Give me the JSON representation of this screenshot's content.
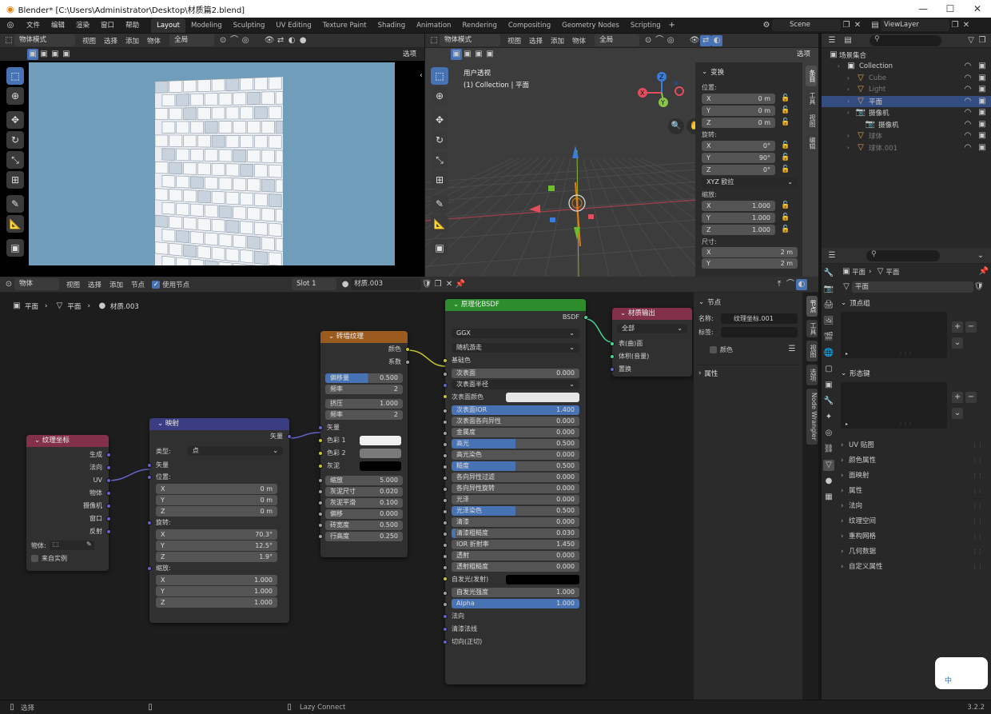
{
  "window": {
    "title": "Blender* [C:\\Users\\Administrator\\Desktop\\材质篇2.blend]",
    "min": "—",
    "max": "☐",
    "close": "✕"
  },
  "menu": [
    "文件",
    "编辑",
    "渲染",
    "窗口",
    "帮助"
  ],
  "workspaces": [
    "Layout",
    "Modeling",
    "Sculpting",
    "UV Editing",
    "Texture Paint",
    "Shading",
    "Animation",
    "Rendering",
    "Compositing",
    "Geometry Nodes",
    "Scripting"
  ],
  "active_workspace": "Layout",
  "scene": "Scene",
  "view_layer": "ViewLayer",
  "left_view": {
    "mode": "物体模式",
    "menus": [
      "视图",
      "选择",
      "添加",
      "物体"
    ],
    "transform": "全局",
    "options": "选项"
  },
  "right_view": {
    "mode": "物体模式",
    "menus": [
      "视图",
      "选择",
      "添加",
      "物体"
    ],
    "transform": "全局",
    "options": "选项",
    "overlay_title": "用户透视",
    "overlay_sub": "(1) Collection | 平面"
  },
  "n_panel": {
    "transform": "变换",
    "location_label": "位置:",
    "location": [
      [
        "X",
        "0 m"
      ],
      [
        "Y",
        "0 m"
      ],
      [
        "Z",
        "0 m"
      ]
    ],
    "rotation_label": "旋转:",
    "rotation": [
      [
        "X",
        "0°"
      ],
      [
        "Y",
        "90°"
      ],
      [
        "Z",
        "0°"
      ]
    ],
    "euler": "XYZ 欧拉",
    "scale_label": "缩放:",
    "scale": [
      [
        "X",
        "1.000"
      ],
      [
        "Y",
        "1.000"
      ],
      [
        "Z",
        "1.000"
      ]
    ],
    "dims_label": "尺寸:",
    "dims": [
      [
        "X",
        "2 m"
      ],
      [
        "Y",
        "2 m"
      ]
    ],
    "tabs": [
      "条目",
      "工具",
      "视图",
      "编辑"
    ]
  },
  "outliner": {
    "root": "场景集合",
    "items": [
      {
        "name": "Collection",
        "level": 1
      },
      {
        "name": "Cube",
        "level": 2,
        "dim": true
      },
      {
        "name": "Light",
        "level": 2,
        "dim": true
      },
      {
        "name": "平面",
        "level": 2,
        "selected": true
      },
      {
        "name": "摄像机",
        "level": 2
      },
      {
        "name": "摄像机",
        "level": 3
      },
      {
        "name": "球体",
        "level": 2,
        "dim": true
      },
      {
        "name": "球体.001",
        "level": 2,
        "dim": true
      }
    ]
  },
  "node_editor": {
    "header": {
      "object": "物体",
      "menus": [
        "视图",
        "选择",
        "添加",
        "节点"
      ],
      "use_nodes": "使用节点",
      "slot": "Slot 1",
      "material": "材质.003"
    },
    "breadcrumb": [
      "平面",
      "平面",
      "材质.003"
    ],
    "tabs": [
      "节点",
      "工具",
      "视图",
      "选项",
      "Node Wrangler"
    ]
  },
  "nodes": {
    "texcoord": {
      "title": "纹理坐标",
      "outputs": [
        "生成",
        "法向",
        "UV",
        "物体",
        "摄像机",
        "窗口",
        "反射"
      ],
      "object_label": "物体:",
      "from_instancer": "来自实例"
    },
    "mapping": {
      "title": "映射",
      "output": "矢量",
      "type_label": "类型:",
      "type": "点",
      "vector": "矢量",
      "location_label": "位置:",
      "location": [
        [
          "X",
          "0 m"
        ],
        [
          "Y",
          "0 m"
        ],
        [
          "Z",
          "0 m"
        ]
      ],
      "rotation_label": "旋转:",
      "rotation": [
        [
          "X",
          "70.3°"
        ],
        [
          "Y",
          "12.5°"
        ],
        [
          "Z",
          "1.9°"
        ]
      ],
      "scale_label": "缩放:",
      "scale": [
        [
          "X",
          "1.000"
        ],
        [
          "Y",
          "1.000"
        ],
        [
          "Z",
          "1.000"
        ]
      ]
    },
    "brick": {
      "title": "砖墙纹理",
      "outputs": [
        "颜色",
        "系数"
      ],
      "offset": [
        "偏移量",
        "0.500"
      ],
      "freq1": [
        "频率",
        "2"
      ],
      "squash": [
        "挤压",
        "1.000"
      ],
      "freq2": [
        "频率",
        "2"
      ],
      "inputs": [
        "矢量",
        "色彩 1",
        "色彩 2",
        "灰泥"
      ],
      "params": [
        [
          "缩放",
          "5.000"
        ],
        [
          "灰泥尺寸",
          "0.020"
        ],
        [
          "灰泥平滑",
          "0.100"
        ],
        [
          "偏移",
          "0.000"
        ],
        [
          "砖宽度",
          "0.500"
        ],
        [
          "行高度",
          "0.250"
        ]
      ]
    },
    "bsdf": {
      "title": "原理化BSDF",
      "output": "BSDF",
      "dist": "GGX",
      "sss_method": "随机游走",
      "base": "基础色",
      "params": [
        {
          "l": "次表面",
          "v": "0.000",
          "p": 0
        },
        {
          "l": "次表面半径",
          "v": "",
          "drop": true
        },
        {
          "l": "次表面颜色",
          "v": "",
          "color": "#e6e6e6"
        },
        {
          "l": "次表面IOR",
          "v": "1.400",
          "p": 100
        },
        {
          "l": "次表面各向异性",
          "v": "0.000",
          "p": 0
        },
        {
          "l": "金属度",
          "v": "0.000",
          "p": 0
        },
        {
          "l": "高光",
          "v": "0.500",
          "p": 50
        },
        {
          "l": "高光染色",
          "v": "0.000",
          "p": 0
        },
        {
          "l": "糙度",
          "v": "0.500",
          "p": 50
        },
        {
          "l": "各向异性过滤",
          "v": "0.000",
          "p": 0
        },
        {
          "l": "各向异性旋转",
          "v": "0.000",
          "p": 0
        },
        {
          "l": "光泽",
          "v": "0.000",
          "p": 0
        },
        {
          "l": "光泽染色",
          "v": "0.500",
          "p": 50
        },
        {
          "l": "清漆",
          "v": "0.000",
          "p": 0
        },
        {
          "l": "清漆粗糙度",
          "v": "0.030",
          "p": 3
        },
        {
          "l": "IOR 折射率",
          "v": "1.450",
          "p": 0
        },
        {
          "l": "透射",
          "v": "0.000",
          "p": 0
        },
        {
          "l": "透射粗糙度",
          "v": "0.000",
          "p": 0
        },
        {
          "l": "自发光(发射)",
          "v": "",
          "color": "#000000"
        },
        {
          "l": "自发光强度",
          "v": "1.000",
          "p": 0
        },
        {
          "l": "Alpha",
          "v": "1.000",
          "p": 100
        }
      ],
      "tail": [
        "法向",
        "清漆法线",
        "切向(正切)"
      ]
    },
    "output": {
      "title": "材质输出",
      "target": "全部",
      "inputs": [
        "表(曲)面",
        "体积(音量)",
        "置换"
      ]
    }
  },
  "node_panel": {
    "section": "节点",
    "name_label": "名称:",
    "name": "纹理坐标.001",
    "label_label": "标签:",
    "color": "颜色",
    "props": "属性"
  },
  "properties": {
    "search": "",
    "crumb": [
      "平面",
      "平面"
    ],
    "mesh_name": "平面",
    "sections": [
      "顶点组",
      "形态键"
    ],
    "accordions": [
      "UV 贴图",
      "颜色属性",
      "面映射",
      "属性",
      "法向",
      "纹理空间",
      "重构网格",
      "几何数据",
      "自定义属性"
    ]
  },
  "statusbar": {
    "select": "选择",
    "lazy": "Lazy Connect",
    "version": "3.2.2"
  },
  "ime": {
    "label": "中"
  }
}
